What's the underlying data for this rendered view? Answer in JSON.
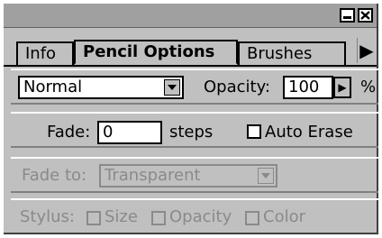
{
  "window": {
    "minimize_icon": "minimize-icon",
    "close_icon": "close-icon"
  },
  "tabs": [
    {
      "label": "Info"
    },
    {
      "label": "Pencil Options",
      "active": true
    },
    {
      "label": "Brushes"
    }
  ],
  "blend_mode": {
    "value": "Normal"
  },
  "opacity": {
    "label": "Opacity:",
    "value": "100",
    "unit": "%"
  },
  "fade": {
    "label": "Fade:",
    "value": "0",
    "unit_label": "steps"
  },
  "auto_erase": {
    "label": "Auto Erase",
    "checked": false
  },
  "fade_to": {
    "label": "Fade to:",
    "value": "Transparent",
    "disabled": true
  },
  "stylus": {
    "label": "Stylus:",
    "options": [
      {
        "label": "Size",
        "checked": false
      },
      {
        "label": "Opacity",
        "checked": false
      },
      {
        "label": "Color",
        "checked": false
      }
    ],
    "disabled": true
  }
}
